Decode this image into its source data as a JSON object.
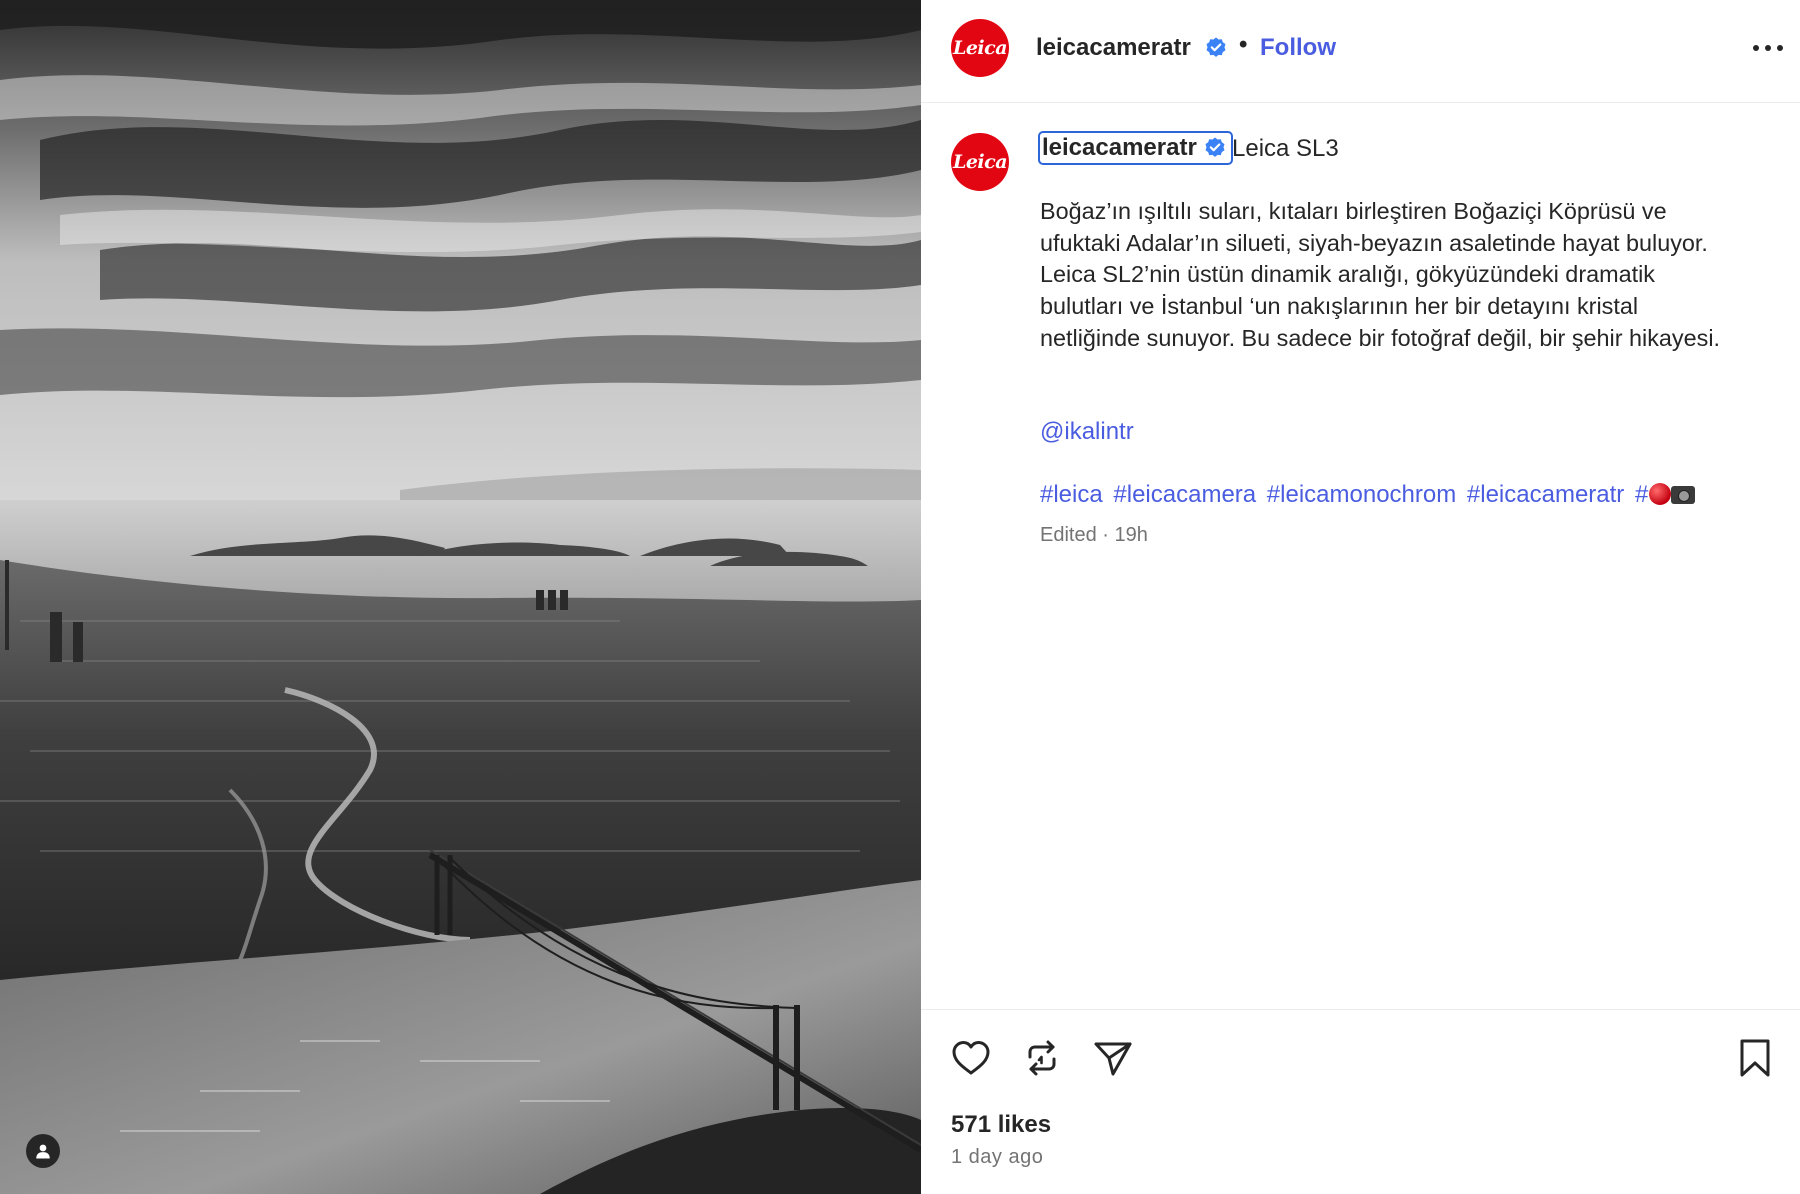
{
  "post": {
    "username": "leicacameratr",
    "avatar_text": "Leica",
    "verified_icon": "verified-badge-icon",
    "separator": "•",
    "follow_label": "Follow",
    "more_icon": "more-options-icon"
  },
  "caption": {
    "author": "leicacameratr",
    "title": "Leica SL3",
    "text": "Boğaz’ın ışıltılı suları, kıtaları birleştiren Boğaziçi Köprüsü ve ufuktaki Adalar’ın silueti, siyah-beyazın asaletinde hayat buluyor. Leica SL2’nin üstün dinamik aralığı, gökyüzündeki dramatik bulutları ve İstanbul ‘un nakışlarının her bir detayını kristal netliğinde sunuyor. Bu sadece bir fotoğraf değil, bir şehir hikayesi.",
    "mention": "@ikalintr",
    "hashtags": [
      "#leica",
      "#leicacamera",
      "#leicamonochrom",
      "#leicacameratr",
      "#"
    ],
    "meta": "Edited · 19h"
  },
  "actions": {
    "likes": "571 likes",
    "time_ago": "1 day ago"
  },
  "colors": {
    "brand_red": "#e20612",
    "link_blue": "#4a5de0",
    "verified_blue": "#3b82f6",
    "muted_text": "#737373"
  }
}
